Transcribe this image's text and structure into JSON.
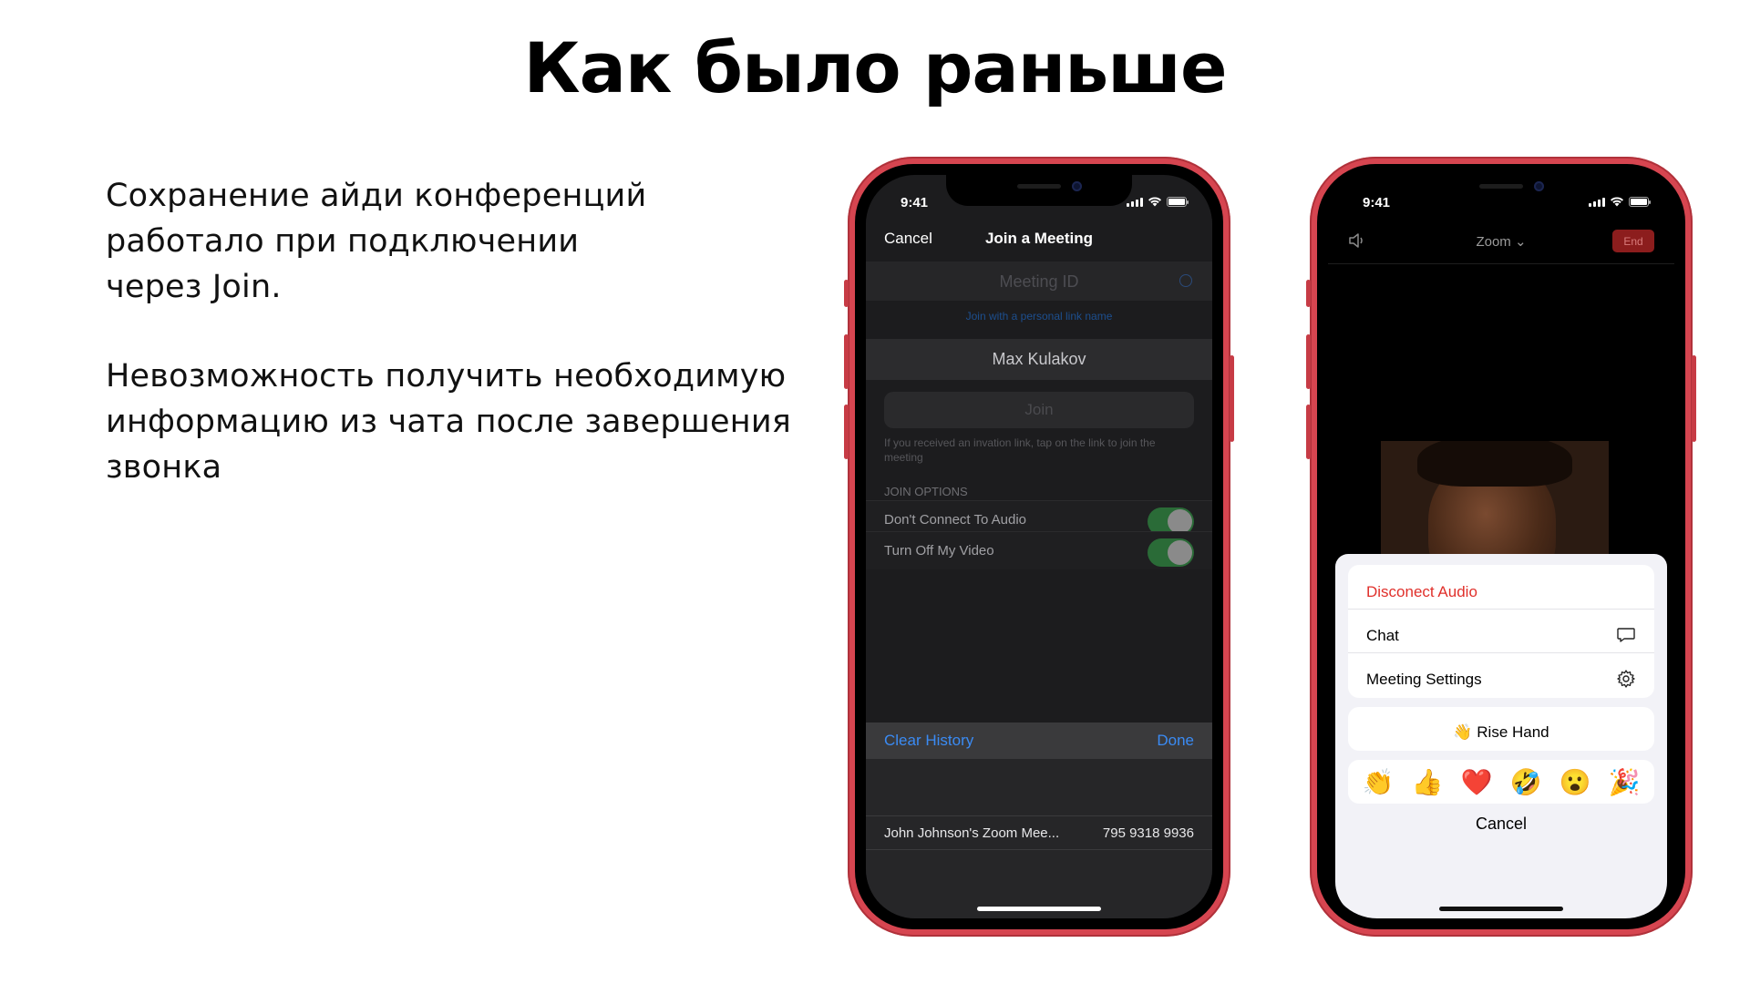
{
  "slide": {
    "title": "Как было раньше",
    "paragraph1": [
      "Сохранение айди конференций",
      "работало при подключении",
      "через Join."
    ],
    "paragraph2": [
      "Невозможность получить необходимую",
      "информацию из чата после завершения",
      "звонка"
    ]
  },
  "colors": {
    "phone_frame": "#d64550",
    "accent_blue": "#3a8bf4",
    "disconnect_red": "#e0302b",
    "toggle_green": "#2a6b37"
  },
  "phone1": {
    "status_time": "9:41",
    "header": {
      "cancel": "Cancel",
      "title": "Join a Meeting"
    },
    "meeting_id_placeholder": "Meeting ID",
    "personal_link": "Join with a personal link name",
    "name_value": "Max Kulakov",
    "join_label": "Join",
    "hint": "If you received an invation link, tap on the link to join the meeting",
    "options_header": "JOIN OPTIONS",
    "options": [
      {
        "label": "Don't Connect To Audio",
        "on": true
      },
      {
        "label": "Turn Off My Video",
        "on": true
      }
    ],
    "toolbar": {
      "clear": "Clear History",
      "done": "Done"
    },
    "history": {
      "name": "John Johnson's Zoom Mee...",
      "number": "795 9318 9936"
    }
  },
  "phone2": {
    "status_time": "9:41",
    "header": {
      "title": "Zoom",
      "end": "End",
      "speaker_icon": "speaker-icon"
    },
    "menu": {
      "disconnect": "Disconect Audio",
      "chat": "Chat",
      "meeting_settings": "Meeting Settings",
      "raise_hand": "Rise Hand",
      "raise_hand_emoji": "👋",
      "reactions": [
        "👏",
        "👍",
        "❤️",
        "🤣",
        "😮",
        "🎉"
      ],
      "cancel": "Cancel"
    }
  }
}
